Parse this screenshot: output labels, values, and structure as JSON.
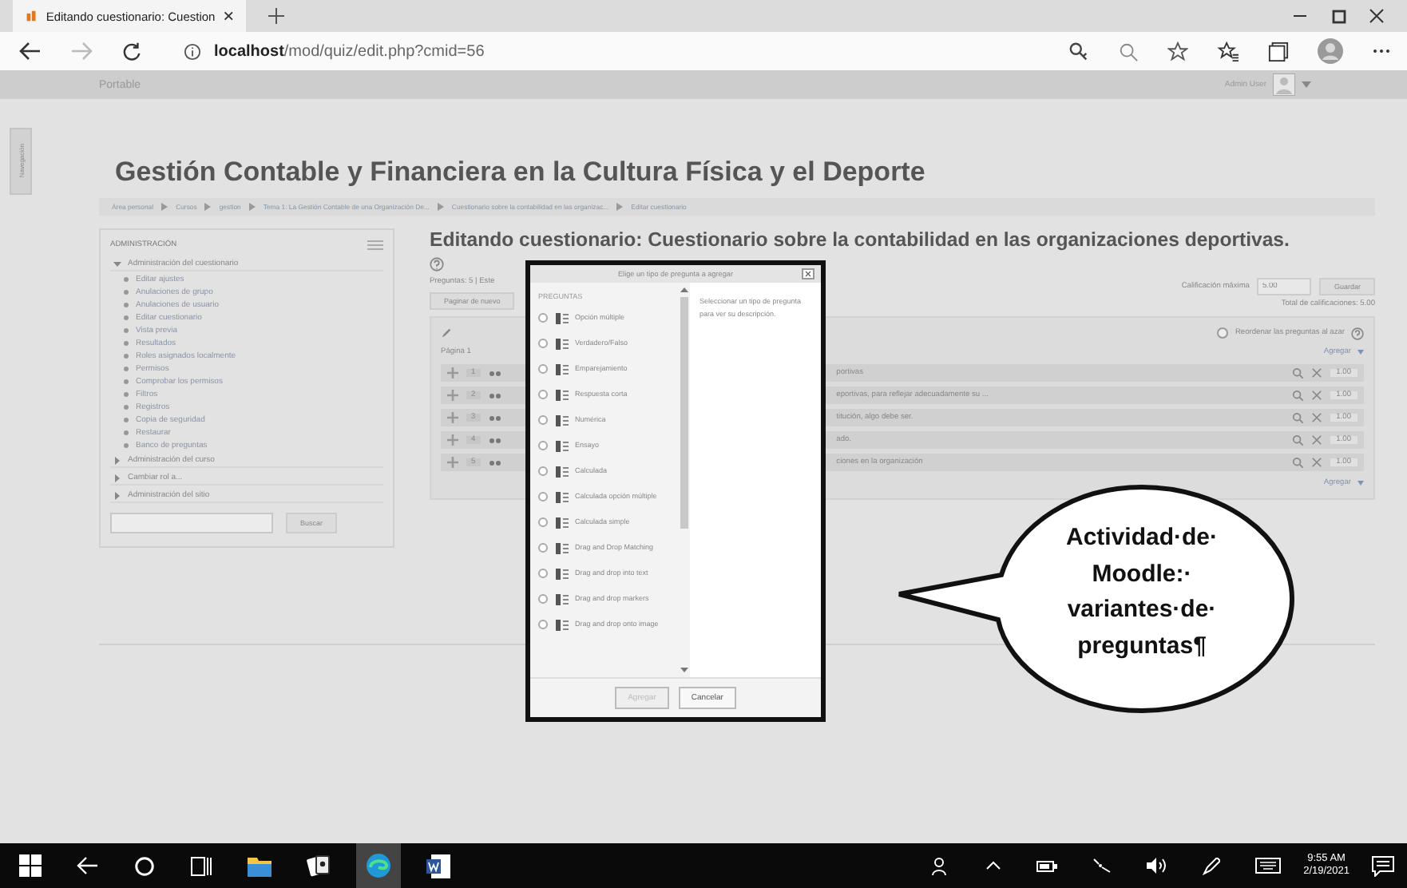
{
  "browser": {
    "tab_title": "Editando cuestionario: Cuestion",
    "url_host": "localhost",
    "url_path": "/mod/quiz/edit.php?cmid=56"
  },
  "site_bar": {
    "brand": "Portable",
    "user": "Admin User"
  },
  "drawer_tab": "Navegación",
  "course_title": "Gestión Contable y Financiera en la Cultura Física y el Deporte",
  "breadcrumb": [
    "Área personal",
    "Cursos",
    "gestion",
    "Tema 1: La Gestión Contable de una Organización De...",
    "Cuestionario sobre la contabilidad en las organizac...",
    "Editar cuestionario"
  ],
  "admin": {
    "heading": "ADMINISTRACIÓN",
    "nodes": [
      {
        "label": "Administración del cuestionario",
        "expanded": true,
        "children": [
          {
            "label": "Editar ajustes"
          },
          {
            "label": "Anulaciones de grupo"
          },
          {
            "label": "Anulaciones de usuario"
          },
          {
            "label": "Editar cuestionario"
          },
          {
            "label": "Vista previa"
          },
          {
            "label": "Resultados"
          },
          {
            "label": "Roles asignados localmente"
          },
          {
            "label": "Permisos"
          },
          {
            "label": "Comprobar los permisos"
          },
          {
            "label": "Filtros"
          },
          {
            "label": "Registros"
          },
          {
            "label": "Copia de seguridad"
          },
          {
            "label": "Restaurar"
          },
          {
            "label": "Banco de preguntas"
          }
        ]
      },
      {
        "label": "Administración del curso",
        "expanded": false
      },
      {
        "label": "Cambiar rol a...",
        "expanded": false
      },
      {
        "label": "Administración del sitio",
        "expanded": false
      }
    ],
    "search_button": "Buscar"
  },
  "quiz": {
    "title": "Editando cuestionario: Cuestionario sobre la contabilidad en las organizaciones deportivas.",
    "summary": "Preguntas: 5 | Este",
    "repaginate_button": "Paginar de nuevo",
    "max_grade_label": "Calificación máxima",
    "max_grade": "5.00",
    "save_button": "Guardar",
    "total": "Total de calificaciones: 5.00",
    "shuffle": {
      "label": "Reordenar las preguntas al azar",
      "checked": false
    },
    "page_label": "Página 1",
    "add_link": "Agregar",
    "questions": [
      {
        "number": "1",
        "text": "portivas",
        "mark": "1.00"
      },
      {
        "number": "2",
        "text": "eportivas, para reflejar adecuadamente su ...",
        "mark": "1.00"
      },
      {
        "number": "3",
        "text": "titución, algo debe ser.",
        "mark": "1.00"
      },
      {
        "number": "4",
        "text": "ado.",
        "mark": "1.00"
      },
      {
        "number": "5",
        "text": "ciones en la organización",
        "mark": "1.00"
      }
    ],
    "add_link_bottom": "Agregar"
  },
  "dialog": {
    "title": "Elige un tipo de pregunta a agregar",
    "section": "PREGUNTAS",
    "description": "Seleccionar un tipo de pregunta para ver su descripción.",
    "types": [
      {
        "label": "Opción múltiple",
        "selected": false
      },
      {
        "label": "Verdadero/Falso",
        "selected": false
      },
      {
        "label": "Emparejamiento",
        "selected": false
      },
      {
        "label": "Respuesta corta",
        "selected": false
      },
      {
        "label": "Numérica",
        "selected": false
      },
      {
        "label": "Ensayo",
        "selected": false
      },
      {
        "label": "Calculada",
        "selected": false
      },
      {
        "label": "Calculada opción múltiple",
        "selected": false
      },
      {
        "label": "Calculada simple",
        "selected": false
      },
      {
        "label": "Drag and Drop Matching",
        "selected": false
      },
      {
        "label": "Drag and drop into text",
        "selected": false
      },
      {
        "label": "Drag and drop markers",
        "selected": false
      },
      {
        "label": "Drag and drop onto image",
        "selected": false
      }
    ],
    "add_button": {
      "label": "Agregar",
      "disabled": true
    },
    "cancel_button": "Cancelar"
  },
  "callout": "Actividad·de· Moodle:· variantes·de· preguntas¶",
  "taskbar": {
    "time": "9:55 AM",
    "date": "2/19/2021"
  }
}
